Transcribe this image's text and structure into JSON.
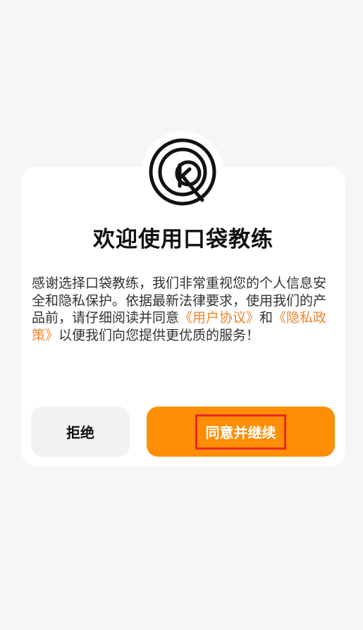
{
  "dialog": {
    "logo": "kq-circle-logo",
    "title": "欢迎使用口袋教练",
    "body": {
      "text_before": "感谢选择口袋教练，我们非常重视您的个人信息安全和隐私保护。依据最新法律要求，使用我们的产品前，请仔细阅读并同意",
      "user_agreement_link": "《用户协议》",
      "conjunction": "和",
      "privacy_policy_link": "《隐私政策》",
      "text_after": "以便我们向您提供更优质的服务！"
    },
    "buttons": {
      "reject_label": "拒绝",
      "accept_label": "同意并继续"
    }
  },
  "colors": {
    "accent": "#fe8e05",
    "link": "#f0862c",
    "highlight_border": "#e8262c",
    "background": "#f6f6f6"
  }
}
